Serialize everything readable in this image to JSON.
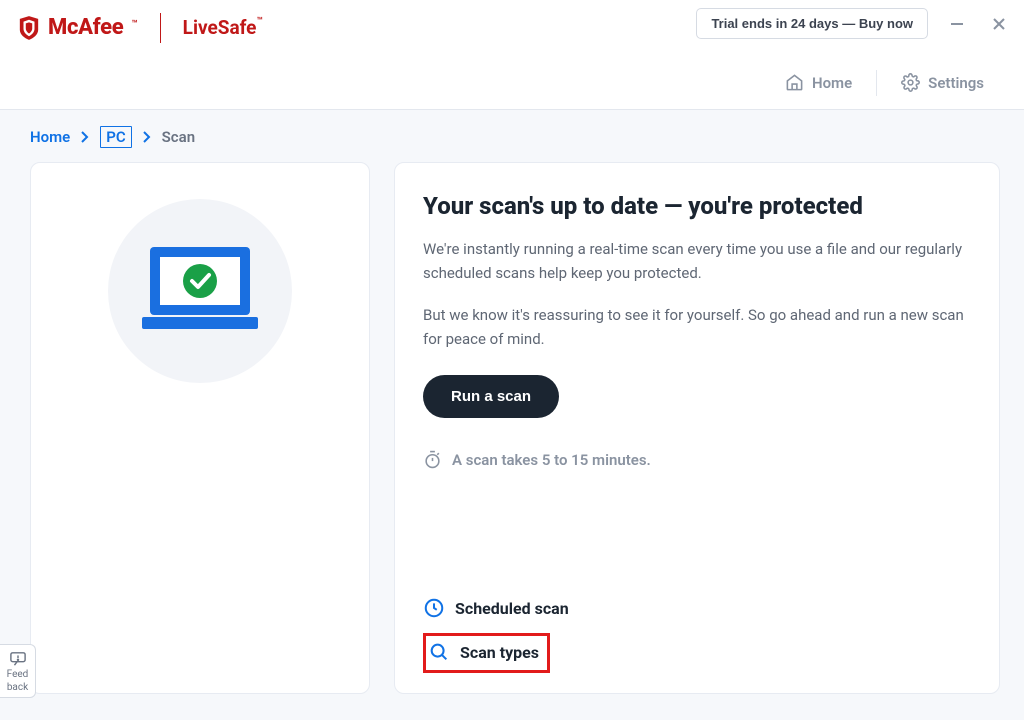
{
  "brand": {
    "name": "McAfee",
    "product": "LiveSafe",
    "tm": "™"
  },
  "titlebar": {
    "trial": "Trial ends in 24 days — Buy now"
  },
  "menubar": {
    "home": "Home",
    "settings": "Settings"
  },
  "breadcrumb": {
    "home": "Home",
    "pc": "PC",
    "scan": "Scan"
  },
  "main": {
    "heading": "Your scan's up to date — you're protected",
    "para1": "We're instantly running a real-time scan every time you use a file and our regularly scheduled scans help keep you protected.",
    "para2": "But we know it's reassuring to see it for yourself. So go ahead and run a new scan for peace of mind.",
    "run_button": "Run a scan",
    "note": "A scan takes 5 to 15 minutes.",
    "link_scheduled": "Scheduled scan",
    "link_types": "Scan types"
  },
  "feedback": {
    "line1": "Feed",
    "line2": "back"
  }
}
